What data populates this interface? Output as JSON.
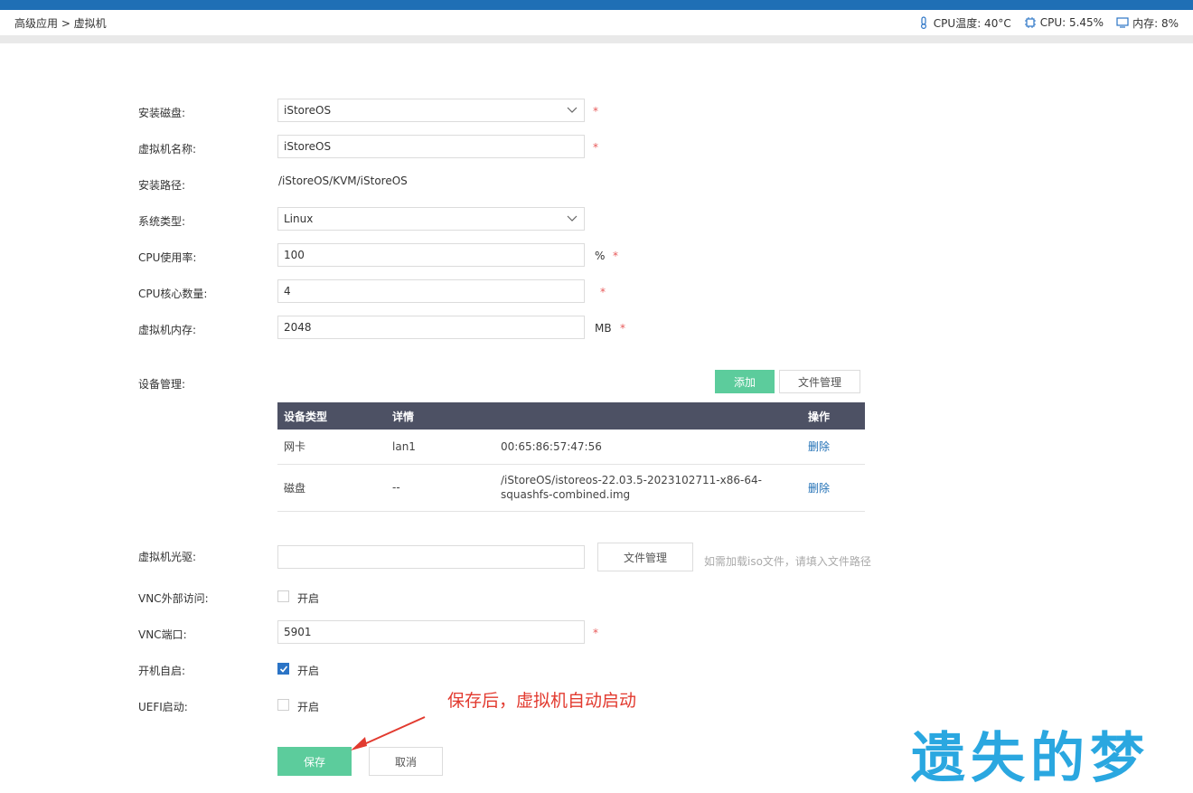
{
  "header": {
    "breadcrumb": "高级应用 > 虚拟机",
    "cpu_temp": "CPU温度: 40°C",
    "cpu_usage": "CPU: 5.45%",
    "memory": "内存: 8%"
  },
  "form": {
    "disk": {
      "label": "安装磁盘:",
      "value": "iStoreOS",
      "required": "*"
    },
    "name": {
      "label": "虚拟机名称:",
      "value": "iStoreOS",
      "required": "*"
    },
    "path": {
      "label": "安装路径:",
      "value": "/iStoreOS/KVM/iStoreOS"
    },
    "os_type": {
      "label": "系统类型:",
      "value": "Linux"
    },
    "cpu_rate": {
      "label": "CPU使用率:",
      "value": "100",
      "unit": "%",
      "required": "*"
    },
    "cpu_cores": {
      "label": "CPU核心数量:",
      "value": "4",
      "required": "*"
    },
    "memory": {
      "label": "虚拟机内存:",
      "value": "2048",
      "unit": "MB",
      "required": "*"
    },
    "devices": {
      "label": "设备管理:",
      "add_button": "添加",
      "file_button": "文件管理",
      "columns": [
        "设备类型",
        "详情",
        "",
        "操作"
      ],
      "rows": [
        {
          "type": "网卡",
          "detail": "lan1",
          "extra": "00:65:86:57:47:56",
          "action": "删除"
        },
        {
          "type": "磁盘",
          "detail": "--",
          "extra": "/iStoreOS/istoreos-22.03.5-2023102711-x86-64-squashfs-combined.img",
          "action": "删除"
        }
      ]
    },
    "cdrom": {
      "label": "虚拟机光驱:",
      "value": "",
      "file_button": "文件管理",
      "hint": "如需加载iso文件，请填入文件路径"
    },
    "vnc_access": {
      "label": "VNC外部访问:",
      "option": "开启",
      "checked": false
    },
    "vnc_port": {
      "label": "VNC端口:",
      "value": "5901",
      "required": "*"
    },
    "autostart": {
      "label": "开机自启:",
      "option": "开启",
      "checked": true
    },
    "uefi": {
      "label": "UEFI启动:",
      "option": "开启",
      "checked": false
    },
    "save_button": "保存",
    "cancel_button": "取消"
  },
  "annotation": {
    "text": "保存后，虚拟机自动启动"
  },
  "watermark": {
    "text": "遗失的梦"
  },
  "colors": {
    "topbar": "#1f6fb5",
    "accent_green": "#5ccc9c",
    "table_header": "#4d5164",
    "link": "#1f6fb5",
    "annotation": "#e23a2f",
    "watermark": "#2aa7e0"
  }
}
